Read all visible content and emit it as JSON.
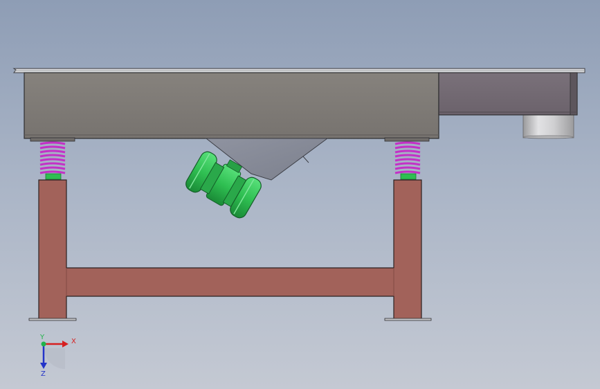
{
  "viewport": {
    "background_top": "#8e9db5",
    "background_bottom": "#c4c9d3"
  },
  "model": {
    "trough_color": "#7c7975",
    "outlet_color": "#716770",
    "frame_color": "#a2625a",
    "spring_color": "#c430c7",
    "motor_color": "#2fbf52",
    "outlet_pipe_color": "#c6c6c8"
  },
  "triad": {
    "x_label": "X",
    "y_label": "Y",
    "z_label": "Z",
    "x_color": "#d61f1f",
    "y_color": "#21b34a",
    "z_color": "#2434c8"
  }
}
